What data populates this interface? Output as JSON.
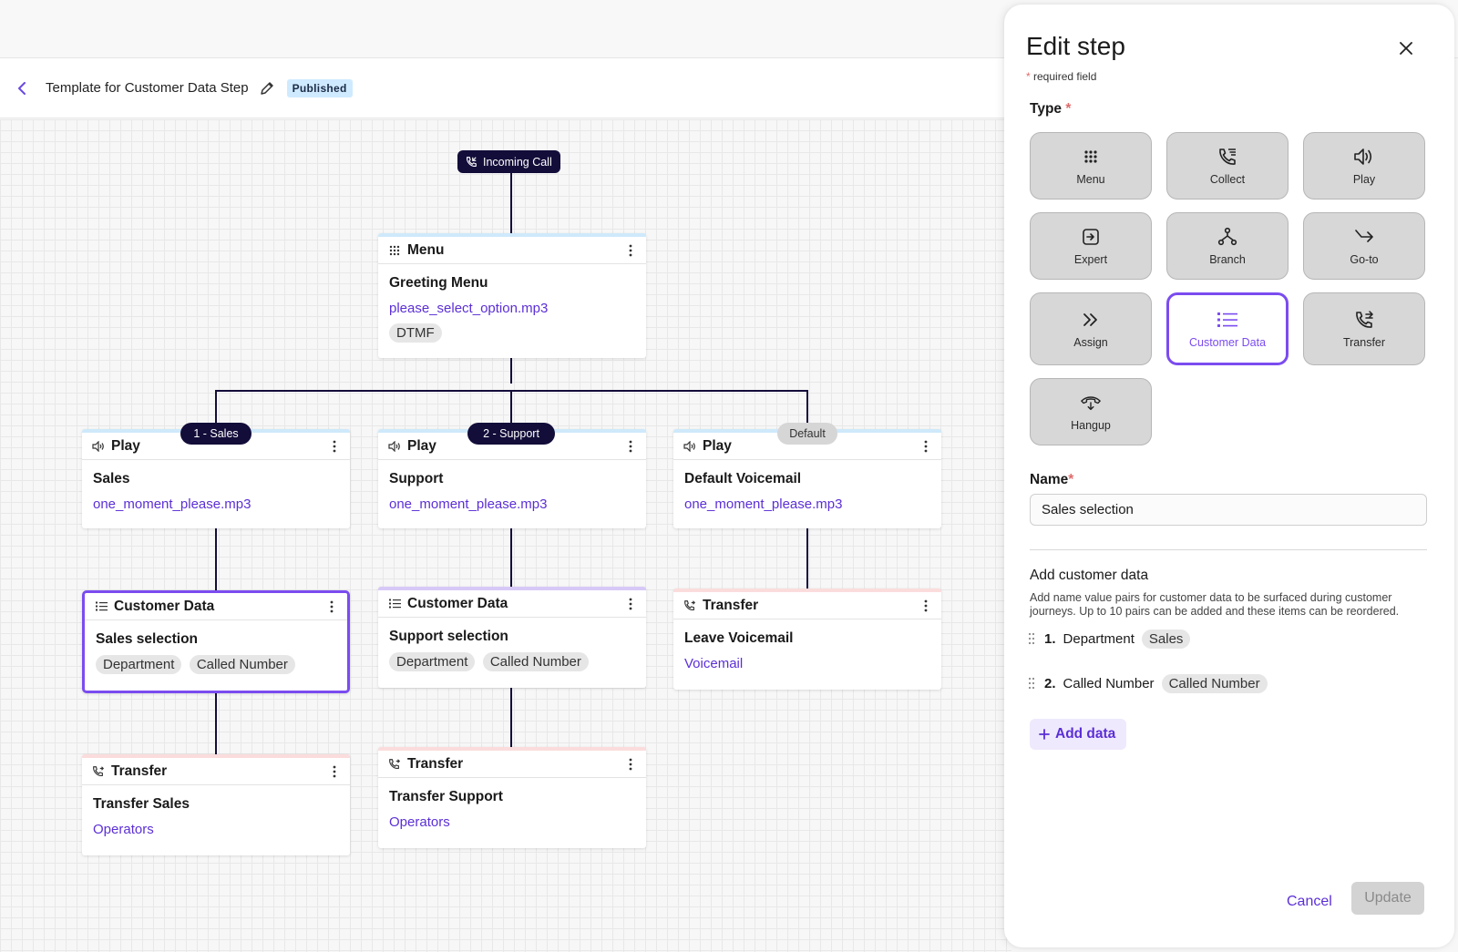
{
  "toolbar": {
    "title": "Template for Customer Data Step",
    "status": "Published"
  },
  "flow": {
    "incoming_call": "Incoming Call",
    "menu_node": {
      "type": "Menu",
      "name": "Greeting Menu",
      "audio": "please_select_option.mp3",
      "chip": "DTMF"
    },
    "branch_labels": {
      "sales": "1 - Sales",
      "support": "2 - Support",
      "default": "Default"
    },
    "play_sales": {
      "type": "Play",
      "name": "Sales",
      "audio": "one_moment_please.mp3"
    },
    "play_support": {
      "type": "Play",
      "name": "Support",
      "audio": "one_moment_please.mp3"
    },
    "play_default": {
      "type": "Play",
      "name": "Default Voicemail",
      "audio": "one_moment_please.mp3"
    },
    "cust_sales": {
      "type": "Customer Data",
      "name": "Sales selection",
      "chips": [
        "Department",
        "Called Number"
      ]
    },
    "cust_support": {
      "type": "Customer Data",
      "name": "Support selection",
      "chips": [
        "Department",
        "Called Number"
      ]
    },
    "xfer_voicemail": {
      "type": "Transfer",
      "name": "Leave Voicemail",
      "target": "Voicemail"
    },
    "xfer_sales": {
      "type": "Transfer",
      "name": "Transfer Sales",
      "target": "Operators"
    },
    "xfer_support": {
      "type": "Transfer",
      "name": "Transfer Support",
      "target": "Operators"
    }
  },
  "panel": {
    "title": "Edit step",
    "required_note": "required field",
    "type_label": "Type",
    "step_types": [
      {
        "label": "Menu",
        "icon": "grid-dots-icon"
      },
      {
        "label": "Collect",
        "icon": "phone-collect-icon"
      },
      {
        "label": "Play",
        "icon": "speaker-icon"
      },
      {
        "label": "Expert",
        "icon": "expert-icon"
      },
      {
        "label": "Branch",
        "icon": "branch-icon"
      },
      {
        "label": "Go-to",
        "icon": "goto-arrow-icon"
      },
      {
        "label": "Assign",
        "icon": "double-chevron-icon"
      },
      {
        "label": "Customer Data",
        "icon": "list-icon"
      },
      {
        "label": "Transfer",
        "icon": "phone-transfer-icon"
      },
      {
        "label": "Hangup",
        "icon": "hangup-icon"
      }
    ],
    "selected_type": "Customer Data",
    "name_label": "Name",
    "name_value": "Sales selection",
    "add_heading": "Add customer data",
    "add_description": "Add name value pairs for customer data to be surfaced during customer journeys. Up to 10 pairs can be added and these items can be reordered.",
    "pairs": [
      {
        "index": "1.",
        "key": "Department",
        "value": "Sales"
      },
      {
        "index": "2.",
        "key": "Called Number",
        "value": "Called Number"
      }
    ],
    "add_button": "Add data",
    "cancel": "Cancel",
    "update": "Update"
  },
  "colors": {
    "accent": "#7b4cf0",
    "link": "#5b2fd6",
    "dark_pill": "#130d3a",
    "published_badge": "#cfeaff"
  }
}
